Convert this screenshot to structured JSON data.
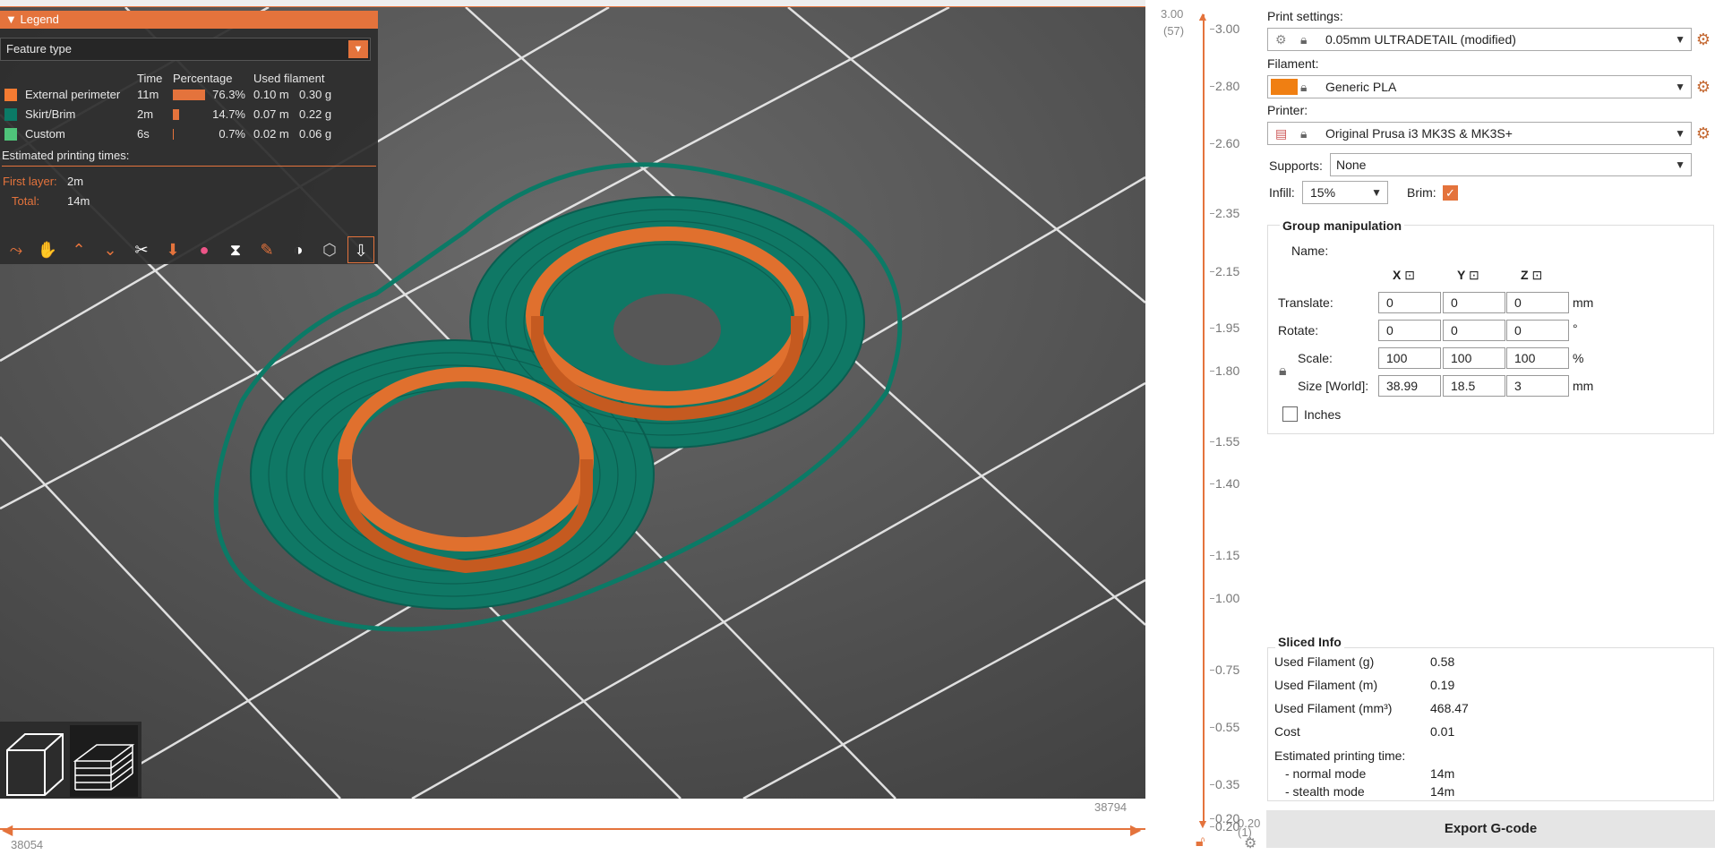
{
  "legend": {
    "title": "Legend",
    "view_type": "Feature type",
    "headers": [
      "Time",
      "Percentage",
      "Used filament"
    ],
    "rows": [
      {
        "name": "External perimeter",
        "time": "11m",
        "pct": "76.3%",
        "pct_value": 76.3,
        "len": "0.10 m",
        "weight": "0.30 g",
        "color": "#f47b32"
      },
      {
        "name": "Skirt/Brim",
        "time": "2m",
        "pct": "14.7%",
        "pct_value": 14.7,
        "len": "0.07 m",
        "weight": "0.22 g",
        "color": "#0b7a66"
      },
      {
        "name": "Custom",
        "time": "6s",
        "pct": "0.7%",
        "pct_value": 0.7,
        "len": "0.02 m",
        "weight": "0.06 g",
        "color": "#4fc47a"
      }
    ],
    "est_title": "Estimated printing times:",
    "first_layer_label": "First layer:",
    "first_layer_value": "2m",
    "total_label": "Total:",
    "total_value": "14m"
  },
  "toolbar_icons": [
    "travel-icon",
    "wipe-icon",
    "retractions-icon",
    "deretractions-icon",
    "seams-icon",
    "tool-changes-icon",
    "color-changes-icon",
    "pause-prints-icon",
    "custom-gcodes-icon",
    "center-of-gravity-icon",
    "shells-icon",
    "tool-marker-icon"
  ],
  "view_tabs": [
    "3d-view-icon",
    "preview-layers-icon"
  ],
  "hslider": {
    "left_value": "38054",
    "right_value": "38794"
  },
  "vslider": {
    "top_value": "3.00",
    "top_layer": "(57)",
    "bottom_value": "0.20",
    "bottom_layer": "(1)",
    "ticks": [
      "3.00",
      "2.80",
      "2.60",
      "2.35",
      "2.15",
      "1.95",
      "1.80",
      "1.55",
      "1.40",
      "1.15",
      "1.00",
      "0.75",
      "0.55",
      "0.35",
      "0.20",
      "0.20"
    ]
  },
  "panel": {
    "print_settings_label": "Print settings:",
    "print_settings_value": "0.05mm ULTRADETAIL (modified)",
    "filament_label": "Filament:",
    "filament_value": "Generic PLA",
    "filament_color": "#f07f12",
    "printer_label": "Printer:",
    "printer_value": "Original Prusa i3 MK3S & MK3S+",
    "supports_label": "Supports:",
    "supports_value": "None",
    "infill_label": "Infill:",
    "infill_value": "15%",
    "brim_label": "Brim:",
    "brim_checked": true
  },
  "group": {
    "title": "Group manipulation",
    "name_label": "Name:",
    "axis_x": "X",
    "axis_y": "Y",
    "axis_z": "Z",
    "translate_label": "Translate:",
    "translate": [
      "0",
      "0",
      "0"
    ],
    "translate_unit": "mm",
    "rotate_label": "Rotate:",
    "rotate": [
      "0",
      "0",
      "0"
    ],
    "rotate_unit": "°",
    "scale_label": "Scale:",
    "scale": [
      "100",
      "100",
      "100"
    ],
    "scale_unit": "%",
    "size_label": "Size [World]:",
    "size": [
      "38.99",
      "18.5",
      "3"
    ],
    "size_unit": "mm",
    "inches_label": "Inches"
  },
  "sliced": {
    "title": "Sliced Info",
    "rows": [
      {
        "label": "Used Filament (g)",
        "value": "0.58"
      },
      {
        "label": "Used Filament (m)",
        "value": "0.19"
      },
      {
        "label": "Used Filament (mm³)",
        "value": "468.47"
      },
      {
        "label": "Cost",
        "value": "0.01"
      }
    ],
    "est_label": "Estimated printing time:",
    "normal_label": "- normal mode",
    "normal_value": "14m",
    "stealth_label": "- stealth mode",
    "stealth_value": "14m"
  },
  "export_label": "Export G-code"
}
